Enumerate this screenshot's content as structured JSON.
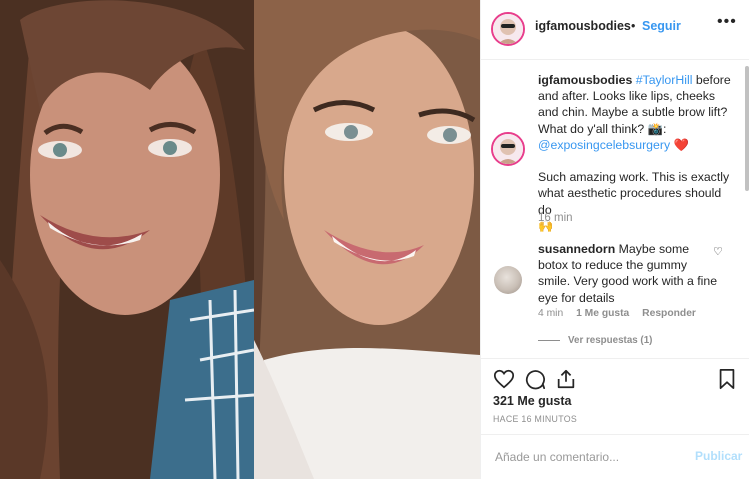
{
  "post": {
    "username": "igfamousbodies",
    "separator": "•",
    "follow_label": "Seguir",
    "more_label": "•••"
  },
  "caption": {
    "username": "igfamousbodies",
    "hashtag": "#TaylorHill",
    "text_1": " before and after. Looks like lips, cheeks and chin. Maybe a subtle brow lift? What do y'all think? 📸:",
    "mention": "@exposingcelebsurgery",
    "emoji_heart": "❤️",
    "text_2": "Such amazing work. This is exactly what aesthetic procedures should do",
    "emoji_hands": "🙌",
    "time": "16 min"
  },
  "comment": {
    "username": "susannedorn",
    "text": " Maybe some botox to reduce the gummy smile. Very good work with a fine eye for details",
    "time": "4 min",
    "likes": "1 Me gusta",
    "reply_label": "Responder",
    "view_replies": "Ver respuestas (1)"
  },
  "actions": {
    "likes_count": "321 Me gusta",
    "timestamp": "HACE 16 MINUTOS",
    "comment_placeholder": "Añade un comentario...",
    "post_label": "Publicar"
  },
  "icons": [
    "heart-icon",
    "comment-icon",
    "share-icon",
    "bookmark-icon",
    "more-options-icon"
  ],
  "colors": {
    "link": "#3897f0",
    "post_disabled": "#b2dffc",
    "muted": "#8e8e8e",
    "avatar_ring": "#e83e8c"
  }
}
